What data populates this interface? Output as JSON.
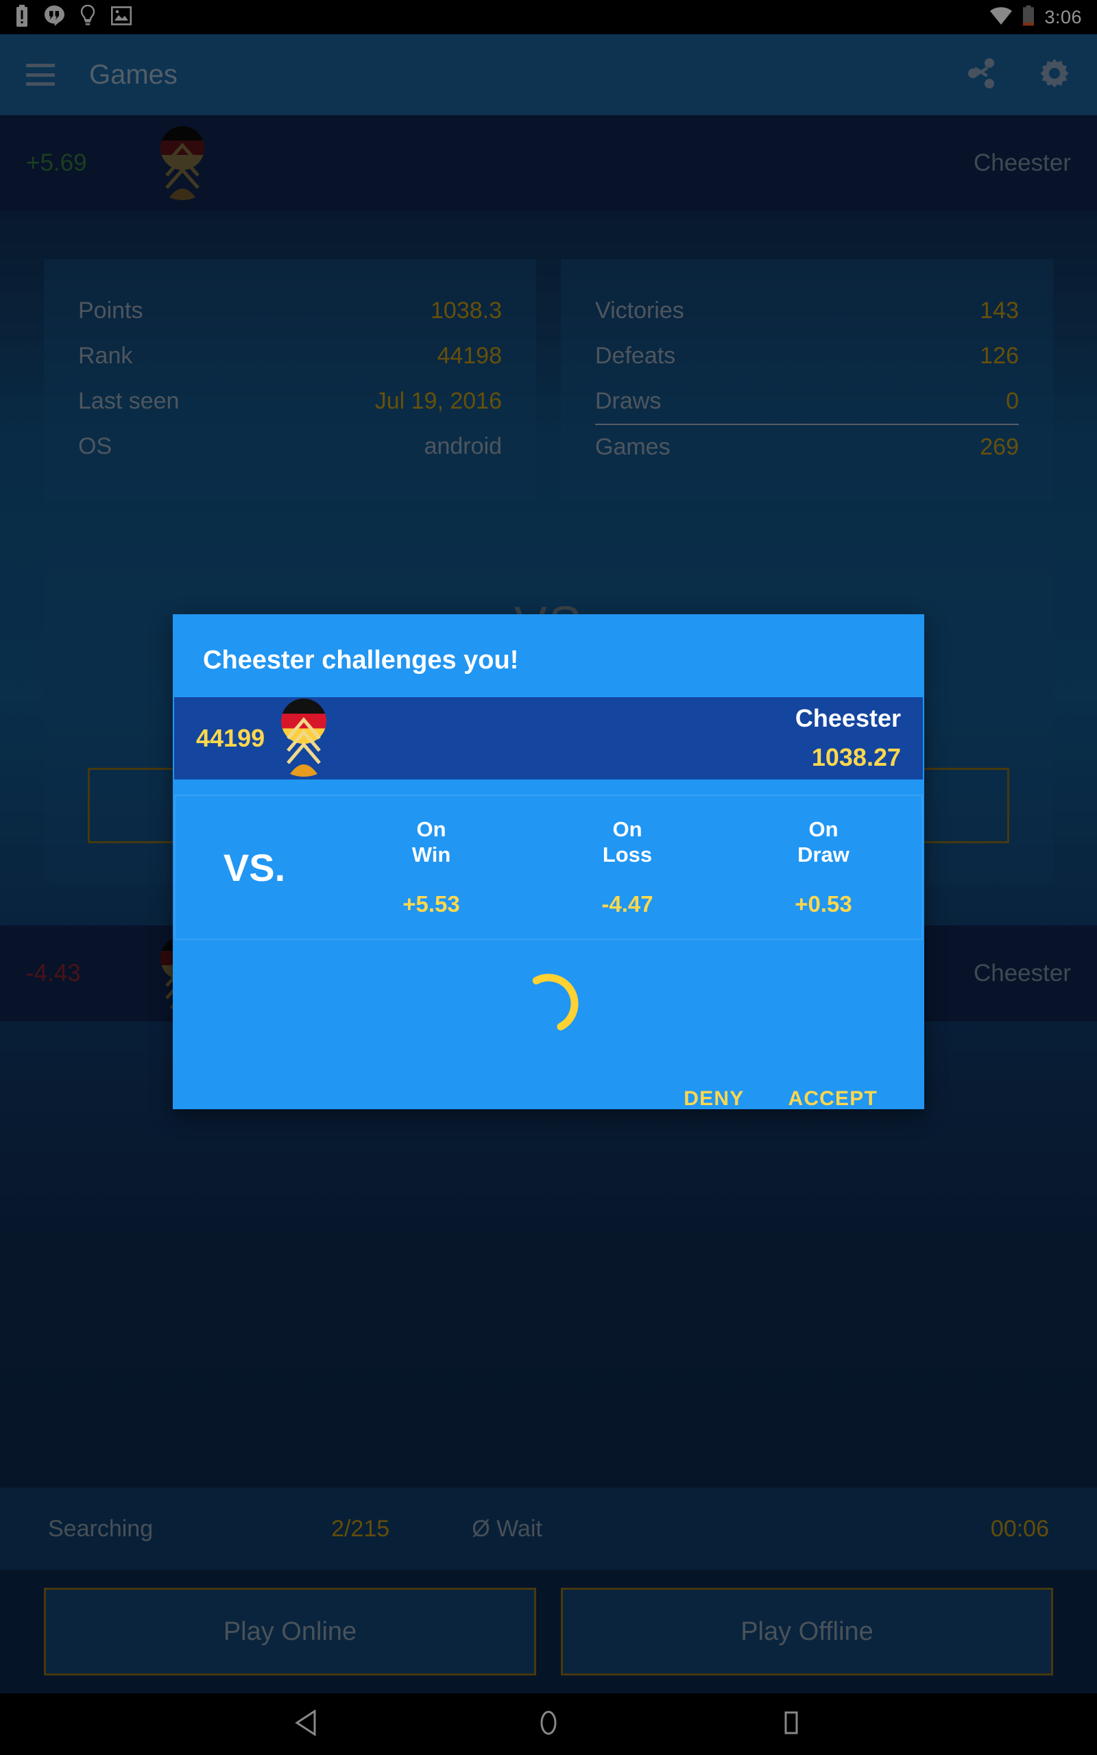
{
  "status_bar": {
    "time": "3:06",
    "icons_left": [
      "battery-alert-icon",
      "hangouts-icon",
      "lightbulb-icon",
      "screenshot-icon"
    ],
    "icons_right": [
      "wifi-icon",
      "battery-low-icon"
    ]
  },
  "app_bar": {
    "menu_icon": "hamburger-menu-icon",
    "title": "Games",
    "share_icon": "share-icon",
    "settings_icon": "gear-icon"
  },
  "opponent_row_top": {
    "delta": "+5.69",
    "name": "Cheester",
    "flag": "germany-flag-icon",
    "rank_badge": "rank-chevron-icon"
  },
  "opponent_row_bottom": {
    "delta": "-4.43",
    "name": "Cheester",
    "flag": "germany-flag-icon",
    "rank_badge": "rank-chevron-icon"
  },
  "stats_left": {
    "rows": [
      {
        "label": "Points",
        "value": "1038.3",
        "muted": false
      },
      {
        "label": "Rank",
        "value": "44198",
        "muted": false
      },
      {
        "label": "Last seen",
        "value": "Jul 19, 2016",
        "muted": false
      },
      {
        "label": "OS",
        "value": "android",
        "muted": true
      }
    ]
  },
  "stats_right": {
    "rows": [
      {
        "label": "Victories",
        "value": "143"
      },
      {
        "label": "Defeats",
        "value": "126"
      },
      {
        "label": "Draws",
        "value": "0"
      },
      {
        "label": "Games",
        "value": "269"
      }
    ]
  },
  "vs_panel": {
    "vs_label": "VS"
  },
  "search_status": {
    "state": "Searching",
    "queue": "2/215",
    "wait_label": "Ø Wait",
    "wait_time": "00:06"
  },
  "bottom_actions": {
    "play_online": "Play Online",
    "play_offline": "Play Offline"
  },
  "nav_bar": {
    "back": "back-triangle-icon",
    "home": "home-circle-icon",
    "recents": "recents-square-icon"
  },
  "dialog": {
    "title": "Cheester challenges you!",
    "opponent": {
      "rank": "44199",
      "flag": "germany-flag-icon",
      "rank_badge": "rank-chevron-icon",
      "name": "Cheester",
      "points": "1038.27"
    },
    "odds": {
      "vs_label": "VS.",
      "columns": [
        {
          "head_line1": "On",
          "head_line2": "Win",
          "value": "+5.53"
        },
        {
          "head_line1": "On",
          "head_line2": "Loss",
          "value": "-4.47"
        },
        {
          "head_line1": "On",
          "head_line2": "Draw",
          "value": "+0.53"
        }
      ]
    },
    "loading_icon": "loading-spinner-icon",
    "deny_label": "DENY",
    "accept_label": "ACCEPT"
  },
  "colors": {
    "accent_blue": "#2196f3",
    "opponent_row_blue": "#14459f",
    "gold": "#ffd84d",
    "amber": "#b08a12",
    "app_bar": "#17598c",
    "page_bg": "#0b1f3d"
  }
}
